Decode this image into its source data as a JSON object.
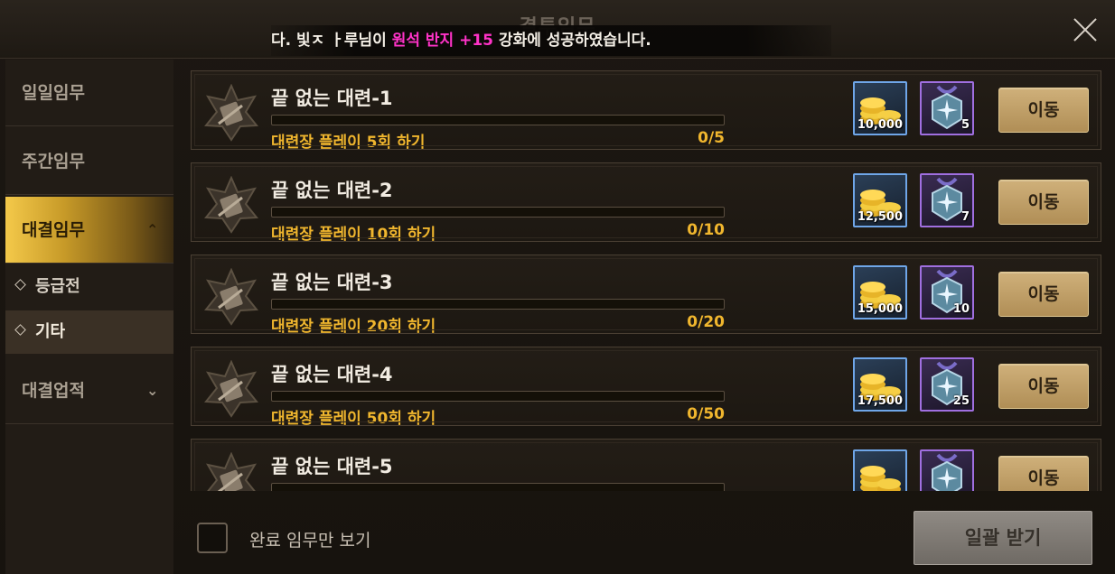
{
  "window": {
    "title": "결투임무",
    "notice": {
      "prefix": "다.       빛ㅈ ㅏ루님이 ",
      "item": "원석 반지 +15",
      "suffix": " 강화에 성공하였습니다."
    }
  },
  "sidebar": {
    "items": [
      {
        "label": "일일임무"
      },
      {
        "label": "주간임무"
      },
      {
        "label": "대결임무",
        "active": true,
        "chevron": "up"
      },
      {
        "label": "대결업적",
        "chevron": "down"
      }
    ],
    "subitems": [
      {
        "label": "등급전"
      },
      {
        "label": "기타",
        "selected": true
      }
    ]
  },
  "quests": [
    {
      "name": "끝 없는 대련-1",
      "desc": "대련장 플레이 5회 하기",
      "progress": "0/5",
      "progress_fraction": 0,
      "gold": "10,000",
      "gem": "5",
      "button": "이동"
    },
    {
      "name": "끝 없는 대련-2",
      "desc": "대련장 플레이 10회 하기",
      "progress": "0/10",
      "progress_fraction": 0,
      "gold": "12,500",
      "gem": "7",
      "button": "이동"
    },
    {
      "name": "끝 없는 대련-3",
      "desc": "대련장 플레이 20회 하기",
      "progress": "0/20",
      "progress_fraction": 0,
      "gold": "15,000",
      "gem": "10",
      "button": "이동"
    },
    {
      "name": "끝 없는 대련-4",
      "desc": "대련장 플레이 50회 하기",
      "progress": "0/50",
      "progress_fraction": 0,
      "gold": "17,500",
      "gem": "25",
      "button": "이동"
    },
    {
      "name": "끝 없는 대련-5",
      "desc": "",
      "progress": "",
      "progress_fraction": 0,
      "gold": "",
      "gem": "",
      "button": "이동"
    }
  ],
  "footer": {
    "checkbox_label": "완료 임무만 보기",
    "checkbox_checked": false,
    "claim_all": "일괄 받기"
  },
  "colors": {
    "accent_gold": "#f0b62e",
    "highlight_pink": "#ff33c8",
    "gold_frame": "#6fa6e8",
    "gem_frame": "#a06fe0"
  },
  "icons": {
    "quest_badge": "scroll-badge-icon",
    "reward_gold": "gold-coins-icon",
    "reward_gem": "blue-gem-icon",
    "close": "close-icon"
  }
}
